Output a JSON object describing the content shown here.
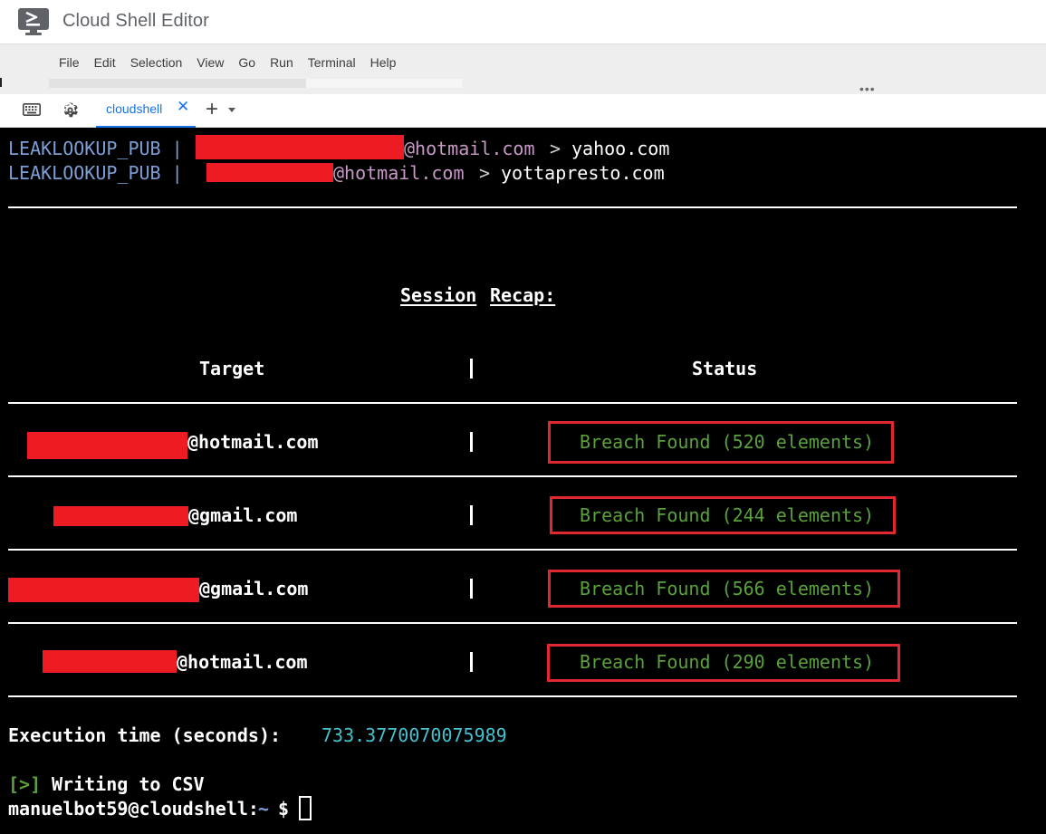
{
  "window": {
    "title": "Cloud Shell Editor",
    "app_icon": "cloud-shell-terminal-icon"
  },
  "menubar": {
    "items": [
      "File",
      "Edit",
      "Selection",
      "View",
      "Go",
      "Run",
      "Terminal",
      "Help"
    ],
    "more_icon": "more-horizontal-icon"
  },
  "tabbar": {
    "keyboard_icon": "keyboard-icon",
    "settings_icon": "gear-icon",
    "tab_label": "cloudshell",
    "tab_close": "✕",
    "add_label": "+",
    "dropdown_icon": "caret-down-icon"
  },
  "terminal": {
    "leak_lines": [
      {
        "source": "LEAKLOOKUP_PUB |",
        "domain": "@hotmail.com",
        "arrow": ">",
        "target": "yahoo.com"
      },
      {
        "source": "LEAKLOOKUP_PUB |",
        "domain": "@hotmail.com",
        "arrow": ">",
        "target": "yottapresto.com"
      }
    ],
    "recap": {
      "title_a": "Session",
      "title_b": "Recap:",
      "header_target": "Target",
      "header_sep": "|",
      "header_status": "Status",
      "rows": [
        {
          "domain": "@hotmail.com",
          "sep": "|",
          "status": "Breach Found (520 elements)"
        },
        {
          "domain": "@gmail.com",
          "sep": "|",
          "status": "Breach Found (244 elements)"
        },
        {
          "domain": "@gmail.com",
          "sep": "|",
          "status": "Breach Found (566 elements)"
        },
        {
          "domain": "@hotmail.com",
          "sep": "|",
          "status": "Breach Found (290 elements)"
        }
      ]
    },
    "execution_label": "Execution time (seconds):",
    "execution_value": "733.3770070075989",
    "writing_prefix": "[>]",
    "writing_text": "Writing to CSV",
    "prompt_user": "manuelbot59@cloudshell:",
    "prompt_path": "~",
    "prompt_symbol": "$",
    "colors": {
      "background": "#000000",
      "source": "#7b9fd6",
      "domain_dim": "#c79ac6",
      "status_green": "#5aa13d",
      "value_teal": "#45c1cf",
      "redaction": "#ed1c24",
      "highlight_box": "#e0282e",
      "tab_accent": "#1a73e8"
    }
  }
}
